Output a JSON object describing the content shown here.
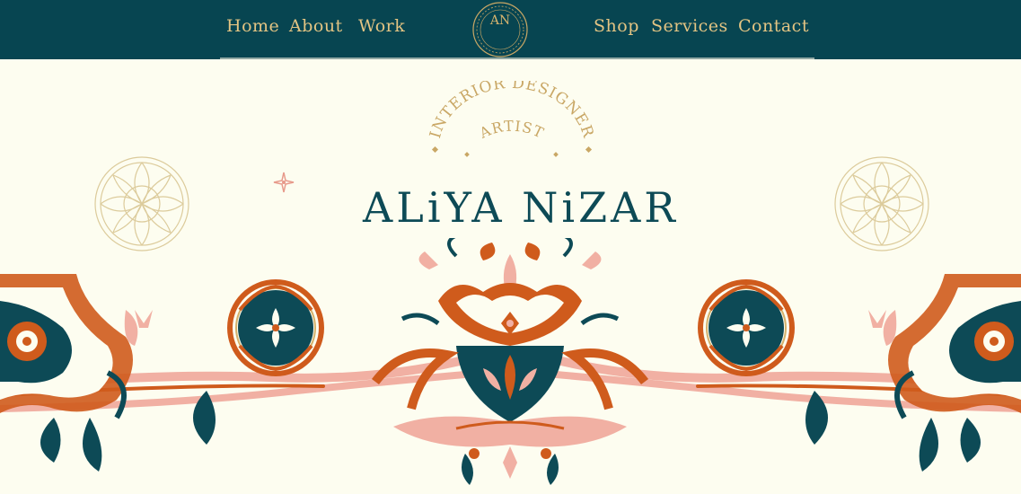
{
  "nav": {
    "left_links": [
      "Home",
      "About",
      "Work"
    ],
    "right_links": [
      "Shop",
      "Services",
      "Contact"
    ],
    "logo_monogram": "AN"
  },
  "hero": {
    "subtitle_line1": "INTERIOR DESIGNER",
    "subtitle_line2": "ARTIST",
    "name": "ALiYA NiZAR"
  },
  "colors": {
    "header_bg": "#074551",
    "nav_text": "#e3c483",
    "page_bg": "#fdfdf0",
    "teal": "#0d4a56",
    "orange": "#cf5b1c",
    "pink": "#f1b0a3",
    "gold": "#d4b06a"
  },
  "icons": [
    "monogram-logo-icon",
    "rosette-left-icon",
    "rosette-right-icon",
    "sparkle-icon",
    "ornament-border"
  ]
}
